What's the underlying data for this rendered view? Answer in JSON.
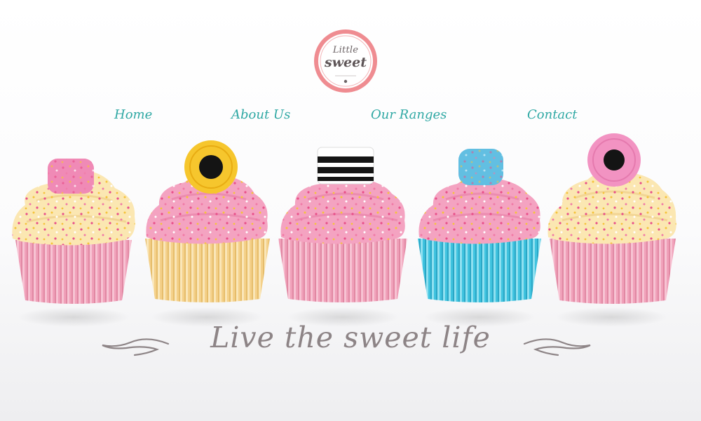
{
  "logo": {
    "line1": "Little",
    "line2": "sweet"
  },
  "nav": {
    "items": [
      {
        "label": "Home"
      },
      {
        "label": "About Us"
      },
      {
        "label": "Our Ranges"
      },
      {
        "label": "Contact"
      }
    ]
  },
  "hero": {
    "tagline": "Live the sweet life",
    "cupcakes": [
      {
        "frosting": "cream",
        "case_color": "#f0a0b9",
        "topper": "pink-sugar-cube"
      },
      {
        "frosting": "pink",
        "case_color": "#f4d089",
        "topper": "yellow-licorice-wheel"
      },
      {
        "frosting": "pink",
        "case_color": "#f0a0b9",
        "topper": "licorice-allsort"
      },
      {
        "frosting": "pink",
        "case_color": "#3fc3df",
        "topper": "blue-sugar-cube"
      },
      {
        "frosting": "cream",
        "case_color": "#f0a0b9",
        "topper": "pink-licorice-wheel"
      }
    ]
  },
  "colors": {
    "accent": "#2fa8a4",
    "logo_ring": "#ef8c91",
    "tagline": "#8d8486",
    "pink_frosting": "#f4a3c1",
    "cream_frosting": "#fbe7b2"
  }
}
